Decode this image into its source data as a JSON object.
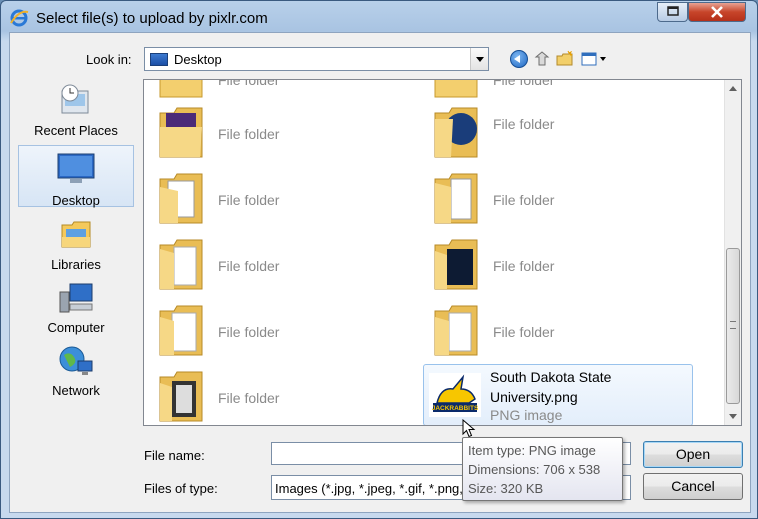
{
  "window": {
    "title": "Select file(s) to upload by pixlr.com",
    "icon": "ie-icon"
  },
  "toolbar": {
    "lookin_label": "Look in:",
    "lookin_value": "Desktop"
  },
  "places": [
    {
      "label": "Recent Places",
      "icon": "recent-places-icon"
    },
    {
      "label": "Desktop",
      "icon": "desktop-icon",
      "selected": true
    },
    {
      "label": "Libraries",
      "icon": "libraries-icon"
    },
    {
      "label": "Computer",
      "icon": "computer-icon"
    },
    {
      "label": "Network",
      "icon": "network-icon"
    }
  ],
  "files": {
    "partial_top_left": "File folder",
    "partial_top_right": "File folder",
    "items": [
      {
        "type": "File folder"
      },
      {
        "type": "File folder"
      },
      {
        "type": "File folder"
      },
      {
        "type": "File folder"
      },
      {
        "type": "File folder"
      },
      {
        "type": "File folder"
      },
      {
        "type": "File folder"
      },
      {
        "type": "File folder"
      },
      {
        "type": "File folder"
      },
      {
        "type": "File folder"
      },
      {
        "type": "File folder"
      },
      {
        "type": "File folder"
      }
    ],
    "selected": {
      "name": "South Dakota State University.png",
      "type": "PNG image",
      "thumb_text": "JACKRABBITS"
    }
  },
  "form": {
    "filename_label": "File name:",
    "filename_value": "",
    "filetype_label": "Files of type:",
    "filetype_value": "Images (*.jpg, *.jpeg, *.gif, *.png,"
  },
  "buttons": {
    "open": "Open",
    "cancel": "Cancel"
  },
  "tooltip": {
    "line1": "Item type: PNG image",
    "line2": "Dimensions: 706 x 538",
    "line3": "Size: 320 KB"
  }
}
